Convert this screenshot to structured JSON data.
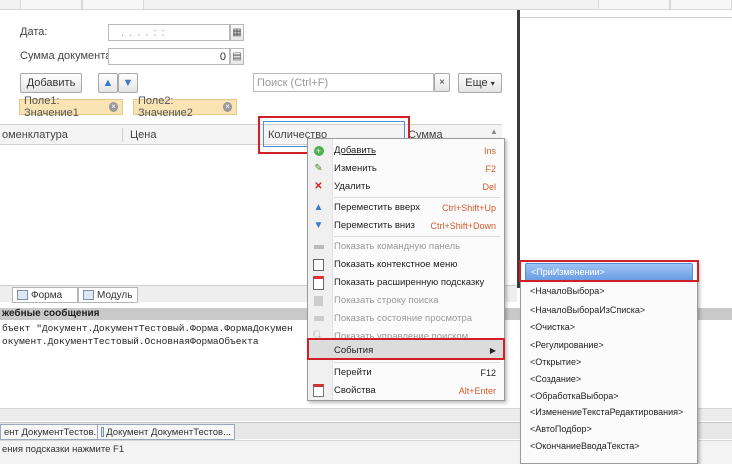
{
  "form": {
    "date_label": "Дата:",
    "date_mask": ". . . . : :",
    "sum_label": "Сумма документа:",
    "sum_value": "0",
    "add_label": "Добавить",
    "search_placeholder": "Поиск (Ctrl+F)",
    "search_clear": "×",
    "more_label": "Еще",
    "filters": [
      "Поле1: Значение1",
      "Поле2: Значение2"
    ],
    "columns": [
      "оменклатура",
      "Цена",
      "Количество",
      "Сумма"
    ]
  },
  "bottom_tabs": [
    "Форма",
    "Модуль"
  ],
  "messages": {
    "title": "жебные сообщения",
    "lines": [
      "бъект \"Документ.ДокументТестовый.Форма.ФормаДокумен",
      "окумент.ДокументТестовый.ОсновнаяФормаОбъекта"
    ]
  },
  "window_tabs": [
    "ент ДокументТестов...",
    "Документ ДокументТестов..."
  ],
  "status_text": "ения подсказки нажмите F1",
  "context_menu": [
    {
      "label": "Добавить",
      "key": "Ins",
      "icon": "plus-circle-icon",
      "disabled": false
    },
    {
      "label": "Изменить",
      "key": "F2",
      "icon": "pencil-icon",
      "disabled": false
    },
    {
      "label": "Удалить",
      "key": "Del",
      "icon": "delete-x-icon",
      "disabled": false
    },
    {
      "label": "Переместить вверх",
      "key": "Ctrl+Shift+Up",
      "icon": "arrow-up-icon",
      "disabled": false
    },
    {
      "label": "Переместить вниз",
      "key": "Ctrl+Shift+Down",
      "icon": "arrow-down-icon",
      "disabled": false
    },
    {
      "label": "Показать командную панель",
      "key": "",
      "icon": "command-panel-icon",
      "disabled": true
    },
    {
      "label": "Показать контекстное меню",
      "key": "",
      "icon": "context-menu-icon",
      "disabled": false
    },
    {
      "label": "Показать расширенную подсказку",
      "key": "",
      "icon": "extended-tooltip-icon",
      "disabled": false
    },
    {
      "label": "Показать строку поиска",
      "key": "",
      "icon": "search-bar-icon",
      "disabled": true
    },
    {
      "label": "Показать состояние просмотра",
      "key": "",
      "icon": "view-state-icon",
      "disabled": true
    },
    {
      "label": "Показать управление поиском",
      "key": "",
      "icon": "search-control-icon",
      "disabled": true
    },
    {
      "label": "События",
      "key": "",
      "icon": "",
      "disabled": false,
      "submenu": true
    },
    {
      "label": "Перейти",
      "key": "F12",
      "icon": "",
      "disabled": false
    },
    {
      "label": "Свойства",
      "key": "Alt+Enter",
      "icon": "properties-icon",
      "disabled": false
    }
  ],
  "events_submenu": [
    "<ПриИзменении>",
    "<НачалоВыбора>",
    "<НачалоВыбораИзСписка>",
    "<Очистка>",
    "<Регулирование>",
    "<Открытие>",
    "<Создание>",
    "<ОбработкаВыбора>",
    "<ИзменениеТекстаРедактирования>",
    "<АвтоПодбор>",
    "<ОкончаниеВводаТекста>"
  ],
  "colors": {
    "highlight_red": "#d11f28",
    "filter_chip": "#fbe4b4",
    "submenu_highlight": "#6a9de6",
    "shortcut_orange": "#d25b2c"
  }
}
